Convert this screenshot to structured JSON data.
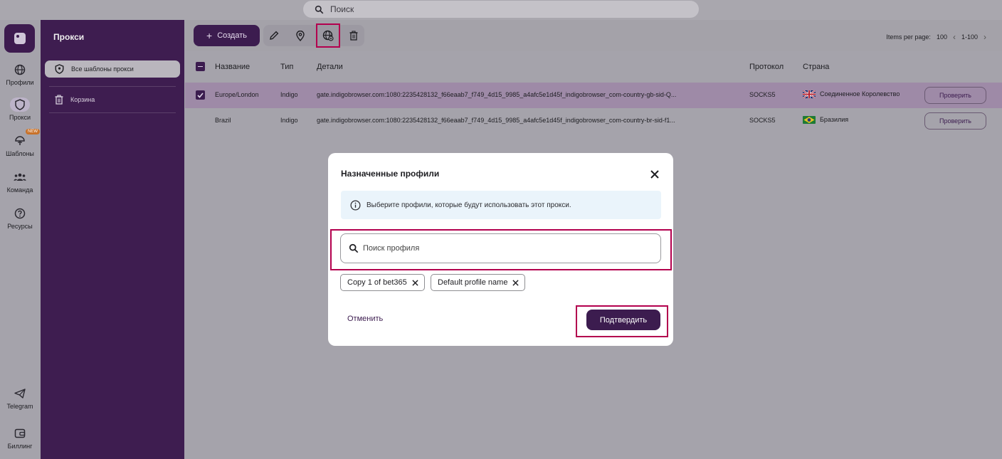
{
  "topbar": {
    "search_placeholder": "Поиск"
  },
  "rail": {
    "items": [
      {
        "label": "Профили",
        "icon": "globe-icon"
      },
      {
        "label": "Прокси",
        "icon": "shield-icon"
      },
      {
        "label": "Шаблоны",
        "icon": "templates-icon",
        "badge": "NEW"
      },
      {
        "label": "Команда",
        "icon": "team-icon"
      },
      {
        "label": "Ресурсы",
        "icon": "help-circle-icon"
      },
      {
        "label": "Telegram",
        "icon": "telegram-icon"
      },
      {
        "label": "Биллинг",
        "icon": "wallet-icon"
      }
    ]
  },
  "sidebar": {
    "title": "Прокси",
    "items": [
      {
        "label": "Все шаблоны прокси",
        "icon": "shield-icon"
      },
      {
        "label": "Корзина",
        "icon": "trash-icon"
      }
    ]
  },
  "toolbar": {
    "create_label": "Создать",
    "pager": {
      "label": "Items per page:",
      "per_page": "100",
      "range": "1-100"
    }
  },
  "table": {
    "headers": {
      "name": "Название",
      "type": "Тип",
      "details": "Детали",
      "protocol": "Протокол",
      "country": "Страна"
    },
    "rows": [
      {
        "name": "Europe/London",
        "type": "Indigo",
        "details": "gate.indigobrowser.com:1080:2235428132_f66eaab7_f749_4d15_9985_a4afc5e1d45f_indigobrowser_com-country-gb-sid-Q...",
        "protocol": "SOCKS5",
        "country": "Соединенное Королевство",
        "flag": "gb",
        "selected": true,
        "check_label": "Проверить"
      },
      {
        "name": "Brazil",
        "type": "Indigo",
        "details": "gate.indigobrowser.com:1080:2235428132_f66eaab7_f749_4d15_9985_a4afc5e1d45f_indigobrowser_com-country-br-sid-f1...",
        "protocol": "SOCKS5",
        "country": "Бразилия",
        "flag": "br",
        "selected": false,
        "check_label": "Проверить"
      }
    ]
  },
  "modal": {
    "title": "Назначенные профили",
    "info": "Выберите профили, которые будут использовать этот прокси.",
    "search_placeholder": "Поиск профиля",
    "chips": [
      "Copy 1 of bet365",
      "Default profile name"
    ],
    "cancel_label": "Отменить",
    "confirm_label": "Подтвердить"
  },
  "colors": {
    "brand": "#3c1c4f",
    "highlight": "#b3004e",
    "info_bg": "#eaf4fb"
  }
}
